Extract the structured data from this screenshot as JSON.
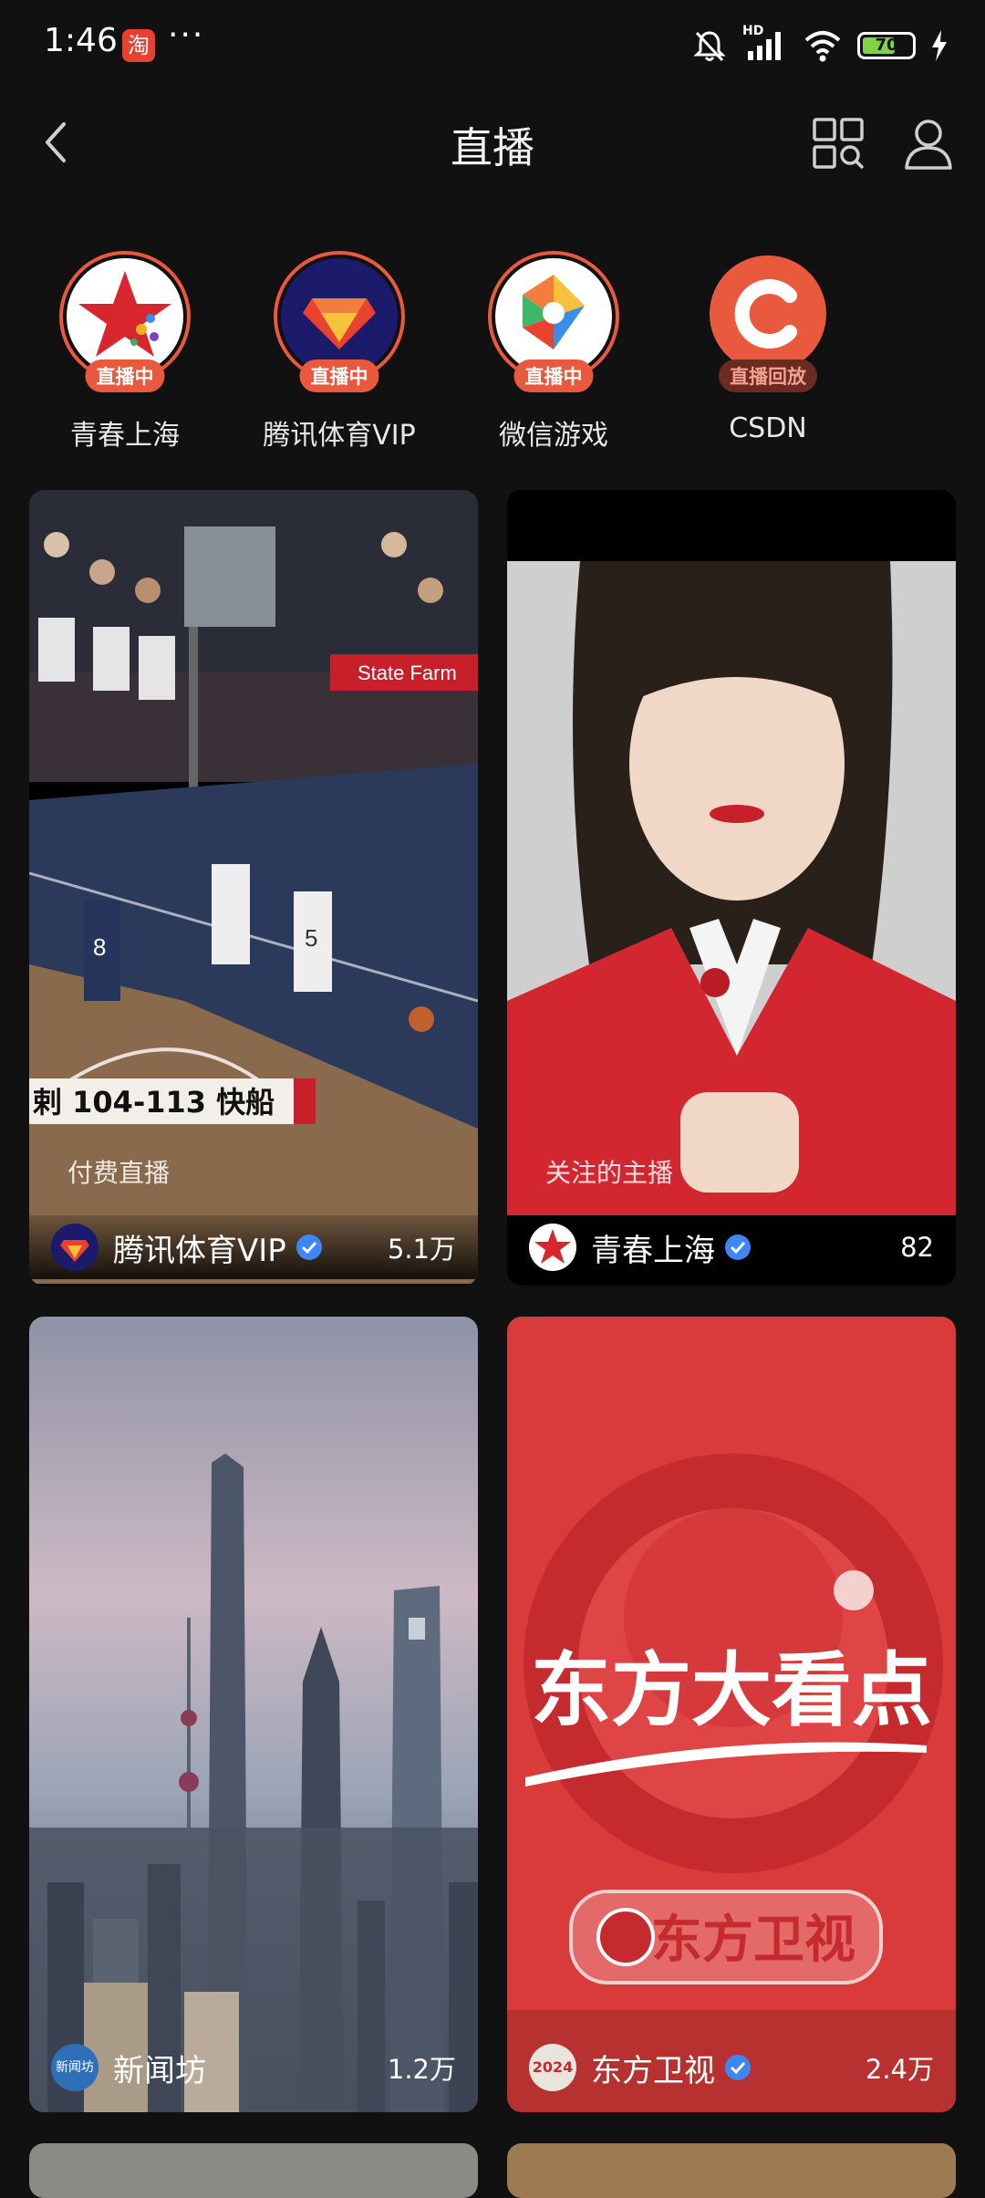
{
  "status_bar": {
    "time": "1:46",
    "app_glyph": "淘",
    "more": "···",
    "network": "HD",
    "battery": "70",
    "battery_level": 0.7,
    "icons": [
      "mute-bell-icon",
      "signal-icon",
      "wifi-icon",
      "battery-icon",
      "charging-bolt-icon"
    ]
  },
  "header": {
    "title": "直播",
    "icons": [
      "back-chevron-icon",
      "grid-search-icon",
      "user-icon"
    ]
  },
  "channels": [
    {
      "name": "青春上海",
      "badge": "直播中",
      "icon": "star-logo-icon"
    },
    {
      "name": "腾讯体育VIP",
      "badge": "直播中",
      "icon": "gem-logo-icon"
    },
    {
      "name": "微信游戏",
      "badge": "直播中",
      "icon": "diamond-logo-icon"
    },
    {
      "name": "CSDN",
      "badge": "直播回放",
      "icon": "c-logo-icon"
    }
  ],
  "cards": [
    {
      "tag": "付费直播",
      "author": "腾讯体育VIP",
      "verified": true,
      "count": "5.1万",
      "scoreboard": "剌 104-113 快船",
      "sponsor": "State Farm",
      "jerseys": [
        "8",
        "5"
      ]
    },
    {
      "tag": "关注的主播",
      "author": "青春上海",
      "verified": true,
      "count": "82"
    },
    {
      "tag": "",
      "author": "新闻坊",
      "verified": false,
      "count": "1.2万",
      "avatar_text": "新闻坊"
    },
    {
      "tag": "",
      "author": "东方卫视",
      "verified": true,
      "count": "2.4万",
      "headline": "东方大看点",
      "channel_logo_text": "东方卫视",
      "avatar_text": "2024"
    }
  ],
  "colors": {
    "accent": "#e9593e",
    "verified": "#3f86f5",
    "background": "#111111"
  }
}
